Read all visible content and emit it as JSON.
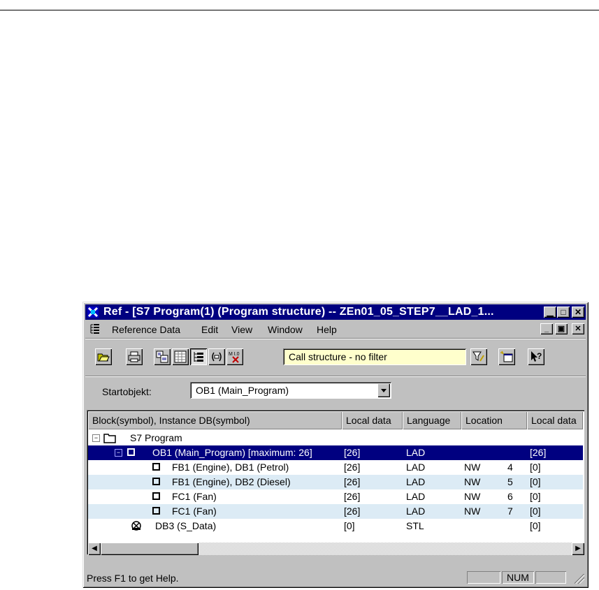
{
  "window": {
    "title": "Ref - [S7 Program(1) (Program structure) -- ZEn01_05_STEP7__LAD_1..."
  },
  "menu": {
    "items": [
      "Reference Data",
      "Edit",
      "View",
      "Window",
      "Help"
    ]
  },
  "toolbar": {
    "filter_text": "Call structure - no filter"
  },
  "start": {
    "label": "Startobjekt:",
    "value": "OB1 (Main_Program)"
  },
  "table": {
    "headers": [
      "Block(symbol), Instance DB(symbol)",
      "Local data",
      "Language",
      "Location",
      "Local data"
    ],
    "rows": [
      {
        "block": "S7 Program",
        "local": "",
        "lang": "",
        "nw": "",
        "nwnum": "",
        "local2": ""
      },
      {
        "block": "OB1 (Main_Program) [maximum: 26]",
        "local": "[26]",
        "lang": "LAD",
        "nw": "",
        "nwnum": "",
        "local2": "[26]"
      },
      {
        "block": "FB1 (Engine), DB1 (Petrol)",
        "local": "[26]",
        "lang": "LAD",
        "nw": "NW",
        "nwnum": "4",
        "local2": "[0]"
      },
      {
        "block": "FB1 (Engine), DB2 (Diesel)",
        "local": "[26]",
        "lang": "LAD",
        "nw": "NW",
        "nwnum": "5",
        "local2": "[0]"
      },
      {
        "block": "FC1 (Fan)",
        "local": "[26]",
        "lang": "LAD",
        "nw": "NW",
        "nwnum": "6",
        "local2": "[0]"
      },
      {
        "block": "FC1 (Fan)",
        "local": "[26]",
        "lang": "LAD",
        "nw": "NW",
        "nwnum": "7",
        "local2": "[0]"
      },
      {
        "block": "DB3 (S_Data)",
        "local": "[0]",
        "lang": "STL",
        "nw": "",
        "nwnum": "",
        "local2": "[0]"
      }
    ]
  },
  "status": {
    "help_text": "Press F1 to get Help.",
    "num": "NUM"
  },
  "colors": {
    "title_bg": "#000080",
    "selected_row": "#000080",
    "alt_row": "#dcebf5",
    "filter_bg": "#ffffcc"
  }
}
